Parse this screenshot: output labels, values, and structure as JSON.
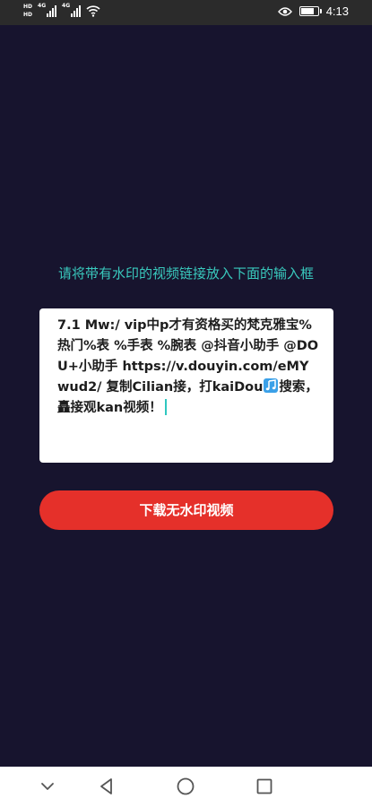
{
  "status_bar": {
    "hd_top": "HD",
    "hd_bottom": "HD",
    "net_1": "4G",
    "net_2": "4G",
    "time": "4:13",
    "battery_level": 0.85,
    "icons": [
      "eye-icon",
      "battery-icon",
      "wifi-icon",
      "signal-icon"
    ]
  },
  "prompt": {
    "text": "请将带有水印的视频链接放入下面的输入框"
  },
  "input": {
    "text_before_icon": "7.1 Mw:/ vip中p才有资格买的梵克雅宝%热门%表 %手表 %腕表 @抖音小助手 @DOU+小助手 https://v.douyin.com/eMYwud2/ 复制Cilian接，打kaiDou",
    "icon": "music-note-icon",
    "text_after_icon": "搜索，矗接观kan视频！"
  },
  "download_button": {
    "label": "下载无水印视频"
  },
  "colors": {
    "background": "#17142e",
    "accent": "#39c9bd",
    "button": "#e5302a"
  },
  "nav_bar": {
    "icons": [
      "chevron-down-icon",
      "back-icon",
      "home-icon",
      "recents-icon"
    ]
  }
}
